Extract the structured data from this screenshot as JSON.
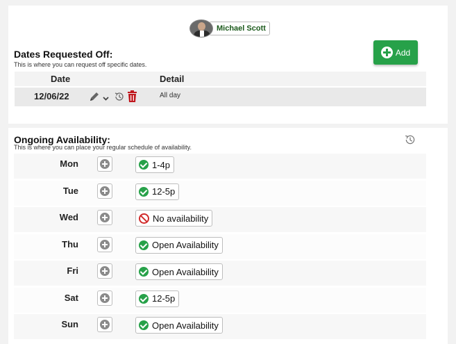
{
  "user": {
    "name": "Michael Scott"
  },
  "dates_off": {
    "title": "Dates Requested Off:",
    "subtitle": "This is where you can request off specific dates.",
    "add_label": "Add",
    "columns": [
      "Date",
      "Detail"
    ],
    "rows": [
      {
        "date": "12/06/22",
        "detail": "All day"
      }
    ]
  },
  "ongoing": {
    "title": "Ongoing Availability:",
    "subtitle": "This is where you can place your regular schedule of availability.",
    "days": [
      {
        "day": "Mon",
        "availability": "1-4p",
        "status": "available"
      },
      {
        "day": "Tue",
        "availability": "12-5p",
        "status": "available"
      },
      {
        "day": "Wed",
        "availability": "No availability",
        "status": "unavailable"
      },
      {
        "day": "Thu",
        "availability": "Open Availability",
        "status": "available"
      },
      {
        "day": "Fri",
        "availability": "Open Availability",
        "status": "available"
      },
      {
        "day": "Sat",
        "availability": "12-5p",
        "status": "available"
      },
      {
        "day": "Sun",
        "availability": "Open Availability",
        "status": "available"
      }
    ]
  },
  "icons": {
    "add": "plus-circle-icon",
    "edit": "pencil-icon",
    "dropdown": "chevron-down-icon",
    "history": "history-icon",
    "delete": "trash-icon",
    "available": "check-circle-icon",
    "unavailable": "ban-icon"
  },
  "colors": {
    "accent": "#27a149",
    "danger": "#d12a2a"
  }
}
